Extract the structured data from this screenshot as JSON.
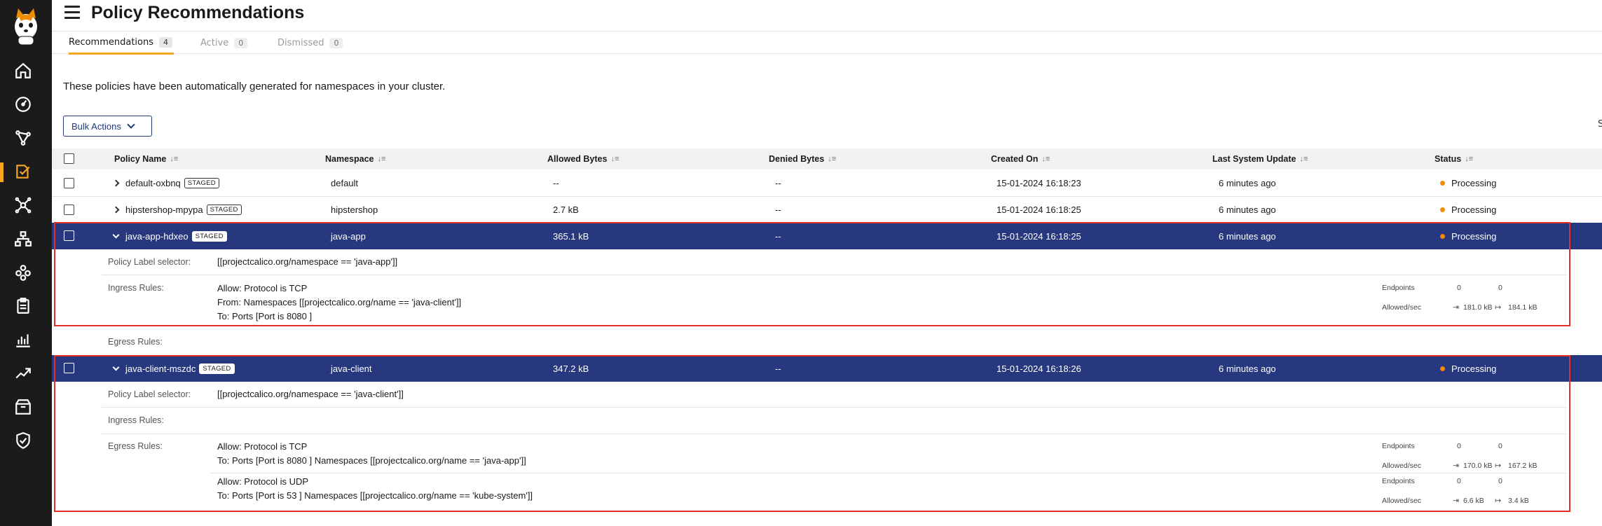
{
  "page": {
    "title": "Policy Recommendations",
    "intro": "These policies have been automatically generated for namespaces in your cluster.",
    "bulk_actions": "Bulk Actions",
    "edge_letter": "S"
  },
  "tabs": [
    {
      "label": "Recommendations",
      "count": "4"
    },
    {
      "label": "Active",
      "count": "0"
    },
    {
      "label": "Dismissed",
      "count": "0"
    }
  ],
  "columns": {
    "policy_name": "Policy Name",
    "namespace": "Namespace",
    "allowed_bytes": "Allowed Bytes",
    "denied_bytes": "Denied Bytes",
    "created_on": "Created On",
    "last_update": "Last System Update",
    "status": "Status"
  },
  "staged_label": "STAGED",
  "rows": [
    {
      "name": "default-oxbnq",
      "namespace": "default",
      "allowed": "--",
      "denied": "--",
      "created": "15-01-2024 16:18:23",
      "updated": "6 minutes ago",
      "status": "Processing"
    },
    {
      "name": "hipstershop-mpypa",
      "namespace": "hipstershop",
      "allowed": "2.7 kB",
      "denied": "--",
      "created": "15-01-2024 16:18:25",
      "updated": "6 minutes ago",
      "status": "Processing"
    },
    {
      "name": "java-app-hdxeo",
      "namespace": "java-app",
      "allowed": "365.1 kB",
      "denied": "--",
      "created": "15-01-2024 16:18:25",
      "updated": "6 minutes ago",
      "status": "Processing"
    },
    {
      "name": "java-client-mszdc",
      "namespace": "java-client",
      "allowed": "347.2 kB",
      "denied": "--",
      "created": "15-01-2024 16:18:26",
      "updated": "6 minutes ago",
      "status": "Processing"
    }
  ],
  "details": {
    "labels": {
      "selector": "Policy Label selector:",
      "ingress": "Ingress Rules:",
      "egress": "Egress Rules:",
      "endpoints": "Endpoints",
      "allowed_sec": "Allowed/sec"
    },
    "java_app": {
      "selector": "[[projectcalico.org/namespace == 'java-app']]",
      "ingress": {
        "line1": "Allow: Protocol is TCP",
        "line2": "From: Namespaces [[projectcalico.org/name == 'java-client']]",
        "line3": "To: Ports [Port is 8080 ]",
        "endpoints_in": "0",
        "endpoints_out": "0",
        "rate_in": "181.0 kB",
        "rate_out": "184.1 kB"
      }
    },
    "java_client": {
      "selector": "[[projectcalico.org/namespace == 'java-client']]",
      "egress1": {
        "line1": "Allow: Protocol is TCP",
        "line2": "To: Ports [Port is 8080 ]  Namespaces [[projectcalico.org/name == 'java-app']]",
        "endpoints_in": "0",
        "endpoints_out": "0",
        "rate_in": "170.0 kB",
        "rate_out": "167.2 kB"
      },
      "egress2": {
        "line1": "Allow: Protocol is UDP",
        "line2": "To: Ports [Port is 53 ]  Namespaces [[projectcalico.org/name == 'kube-system']]",
        "endpoints_in": "0",
        "endpoints_out": "0",
        "rate_in": "6.6 kB",
        "rate_out": "3.4 kB"
      }
    }
  },
  "colors": {
    "accent": "#f5a623",
    "selected_row": "#27387e",
    "highlight_border": "#e0322a",
    "sidebar": "#1b1b1b",
    "status_processing": "#f08c00"
  }
}
